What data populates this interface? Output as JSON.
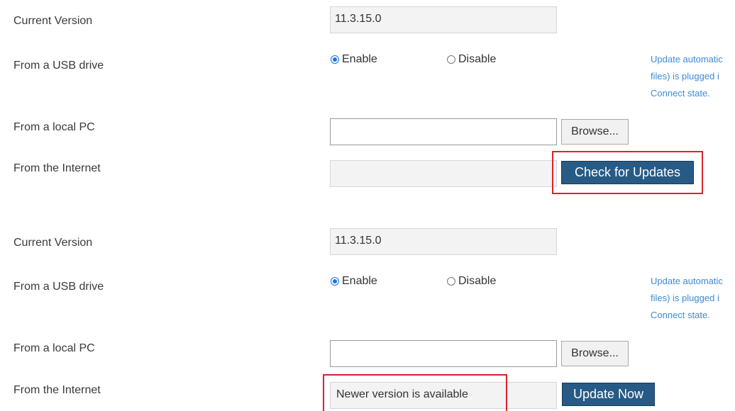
{
  "section1": {
    "current_version_label": "Current Version",
    "current_version_value": "11.3.15.0",
    "usb_label": "From a USB drive",
    "usb_enable_label": "Enable",
    "usb_disable_label": "Disable",
    "usb_selected": "Enable",
    "hint_line1": "Update automatic",
    "hint_line2": "files) is plugged i",
    "hint_line3": "Connect state.",
    "local_pc_label": "From a local PC",
    "local_pc_value": "",
    "browse_label": "Browse...",
    "internet_label": "From the Internet",
    "internet_value": "",
    "check_updates_label": "Check for Updates"
  },
  "section2": {
    "current_version_label": "Current Version",
    "current_version_value": "11.3.15.0",
    "usb_label": "From a USB drive",
    "usb_enable_label": "Enable",
    "usb_disable_label": "Disable",
    "usb_selected": "Enable",
    "hint_line1": "Update automatic",
    "hint_line2": "files) is plugged i",
    "hint_line3": "Connect state.",
    "local_pc_label": "From a local PC",
    "local_pc_value": "",
    "browse_label": "Browse...",
    "internet_label": "From the Internet",
    "internet_value": "Newer version  is available",
    "update_now_label": "Update Now"
  },
  "colors": {
    "primary_button": "#275b86",
    "highlight": "#d9232a",
    "hint_text": "#3d8bd4",
    "radio_checked": "#1a73e8"
  }
}
